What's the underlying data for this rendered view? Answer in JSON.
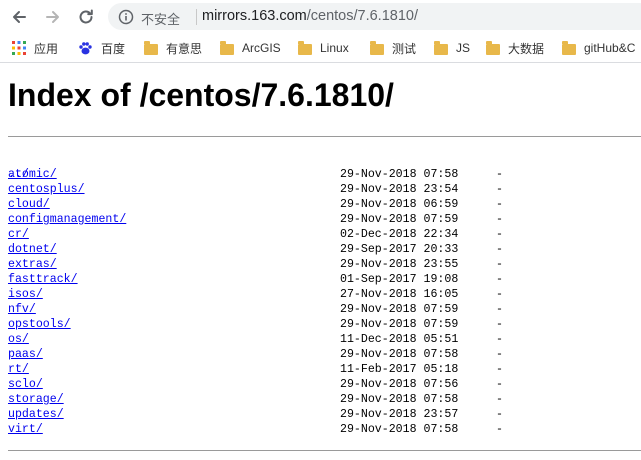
{
  "browser": {
    "insecure_label": "不安全",
    "url_host": "mirrors.163.com",
    "url_path": "/centos/7.6.1810/"
  },
  "bookmarks": [
    {
      "label": "应用",
      "icon": "apps-grid-icon"
    },
    {
      "label": "百度",
      "icon": "baidu-paw-icon"
    },
    {
      "label": "有意思",
      "icon": "folder-icon"
    },
    {
      "label": "ArcGIS",
      "icon": "folder-icon"
    },
    {
      "label": "Linux",
      "icon": "folder-icon"
    },
    {
      "label": "测试",
      "icon": "folder-icon"
    },
    {
      "label": "JS",
      "icon": "folder-icon"
    },
    {
      "label": "大数据",
      "icon": "folder-icon"
    },
    {
      "label": "gitHub&C",
      "icon": "folder-icon"
    }
  ],
  "page": {
    "title": "Index of /centos/7.6.1810/",
    "parent_link": "../",
    "entries": [
      {
        "name": "atomic/",
        "date": "29-Nov-2018 07:58",
        "size": "-"
      },
      {
        "name": "centosplus/",
        "date": "29-Nov-2018 23:54",
        "size": "-"
      },
      {
        "name": "cloud/",
        "date": "29-Nov-2018 06:59",
        "size": "-"
      },
      {
        "name": "configmanagement/",
        "date": "29-Nov-2018 07:59",
        "size": "-"
      },
      {
        "name": "cr/",
        "date": "02-Dec-2018 22:34",
        "size": "-"
      },
      {
        "name": "dotnet/",
        "date": "29-Sep-2017 20:33",
        "size": "-"
      },
      {
        "name": "extras/",
        "date": "29-Nov-2018 23:55",
        "size": "-"
      },
      {
        "name": "fasttrack/",
        "date": "01-Sep-2017 19:08",
        "size": "-"
      },
      {
        "name": "isos/",
        "date": "27-Nov-2018 16:05",
        "size": "-"
      },
      {
        "name": "nfv/",
        "date": "29-Nov-2018 07:59",
        "size": "-"
      },
      {
        "name": "opstools/",
        "date": "29-Nov-2018 07:59",
        "size": "-"
      },
      {
        "name": "os/",
        "date": "11-Dec-2018 05:51",
        "size": "-"
      },
      {
        "name": "paas/",
        "date": "29-Nov-2018 07:58",
        "size": "-"
      },
      {
        "name": "rt/",
        "date": "11-Feb-2017 05:18",
        "size": "-"
      },
      {
        "name": "sclo/",
        "date": "29-Nov-2018 07:56",
        "size": "-"
      },
      {
        "name": "storage/",
        "date": "29-Nov-2018 07:58",
        "size": "-"
      },
      {
        "name": "updates/",
        "date": "29-Nov-2018 23:57",
        "size": "-"
      },
      {
        "name": "virt/",
        "date": "29-Nov-2018 07:58",
        "size": "-"
      }
    ]
  }
}
